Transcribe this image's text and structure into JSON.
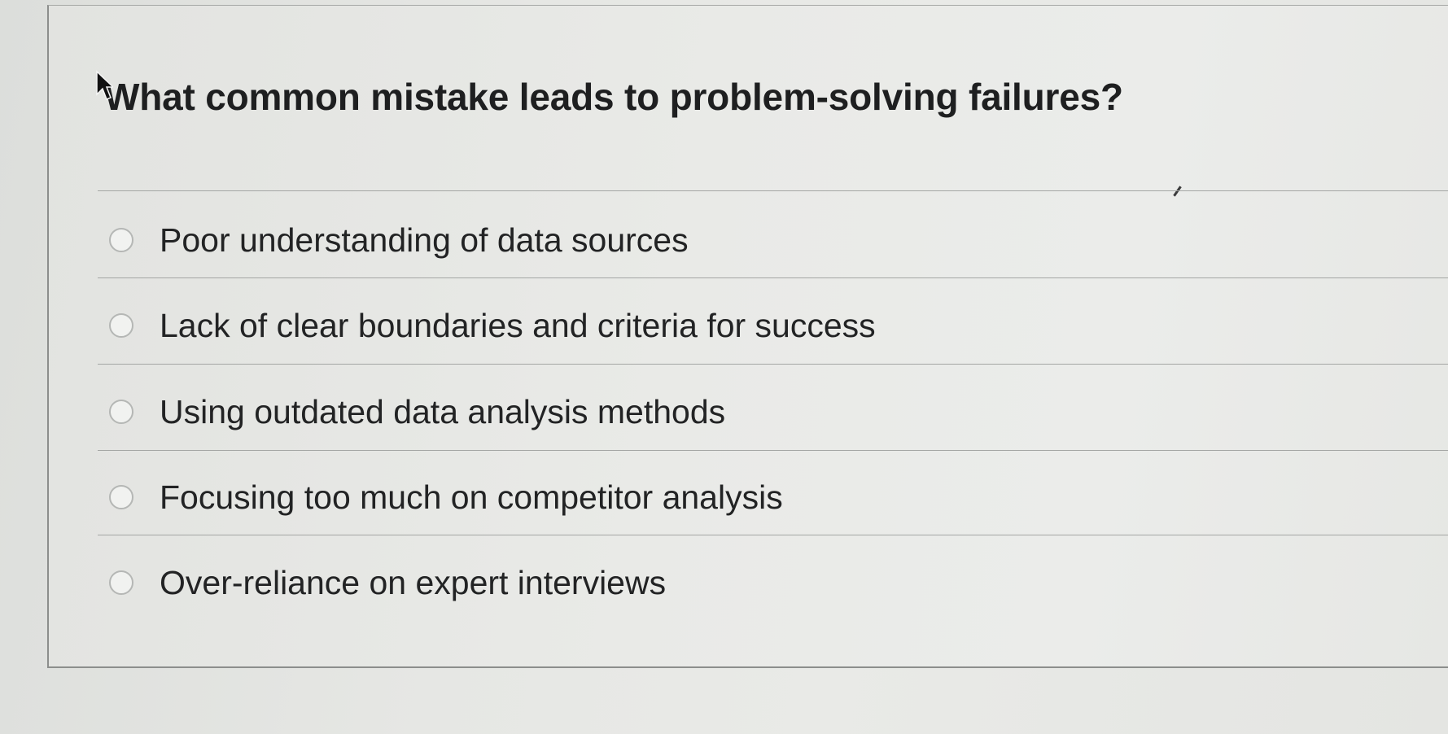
{
  "question": {
    "text": "What common mistake leads to problem-solving failures?"
  },
  "options": [
    {
      "label": "Poor understanding of data sources",
      "selected": false
    },
    {
      "label": "Lack of clear boundaries and criteria for success",
      "selected": false
    },
    {
      "label": "Using outdated data analysis methods",
      "selected": false
    },
    {
      "label": "Focusing too much on competitor analysis",
      "selected": false
    },
    {
      "label": "Over-reliance on expert interviews",
      "selected": false
    }
  ],
  "colors": {
    "background": "#e3e4e1",
    "text": "#222324",
    "divider": "#a4a6a4",
    "radio_border": "#b5b7b5"
  },
  "icons": {
    "cursor": "mouse-pointer-icon",
    "radio": "radio-unchecked-icon"
  }
}
